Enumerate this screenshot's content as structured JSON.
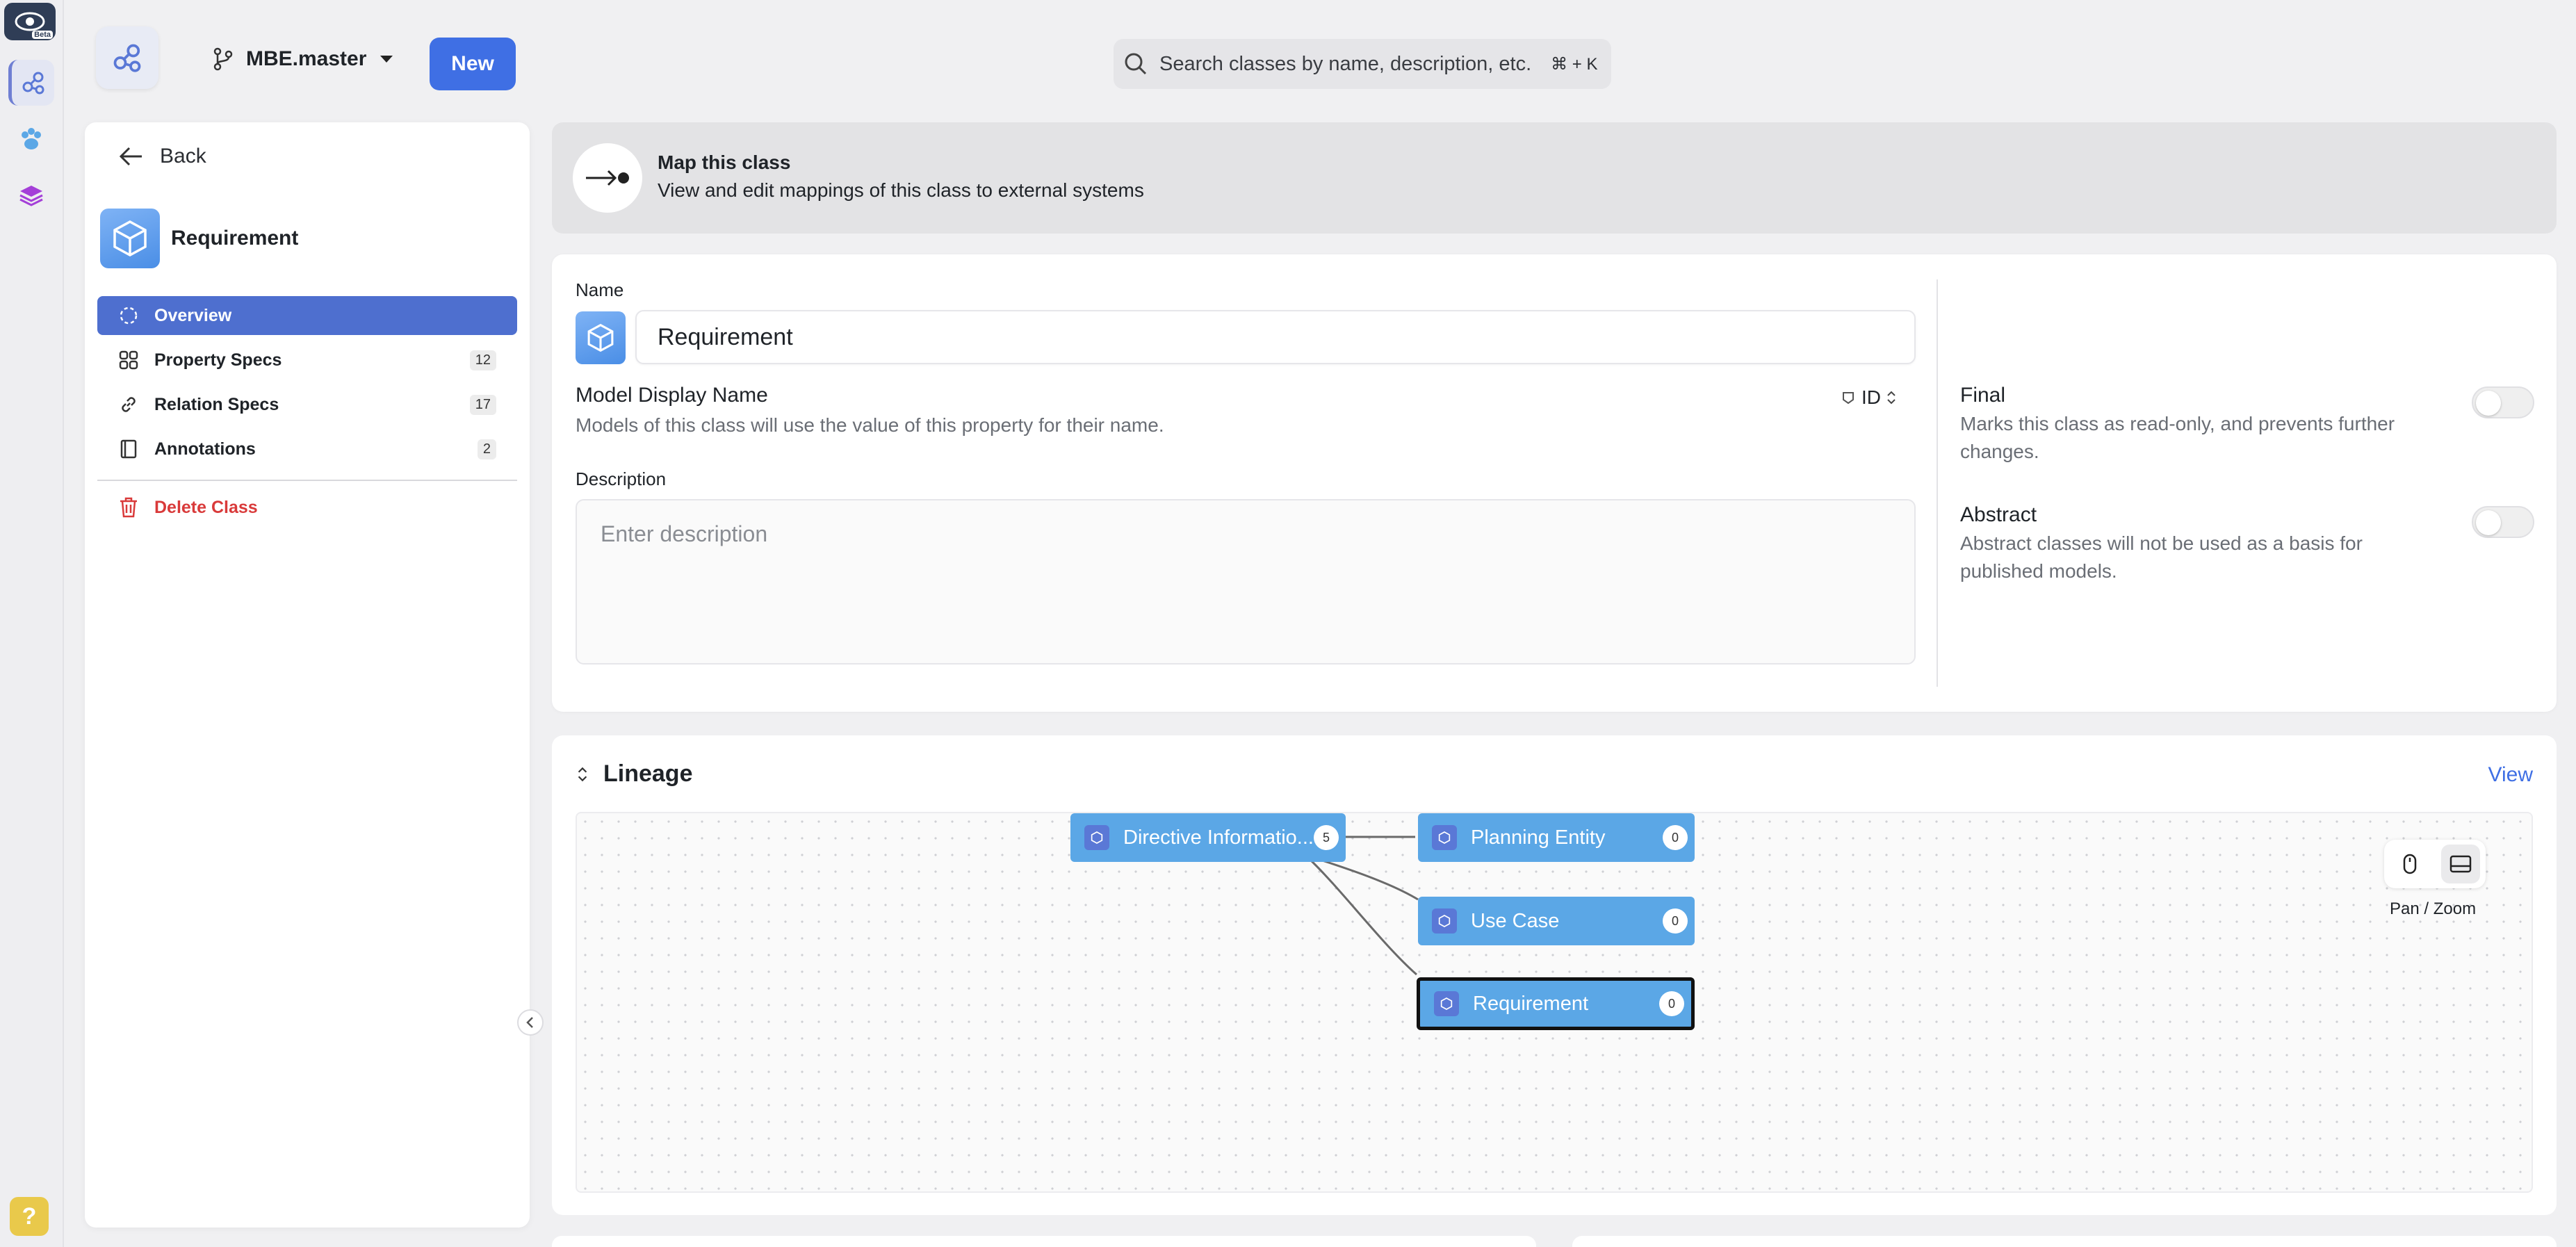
{
  "app": {
    "beta_label": "Beta",
    "help_label": "?",
    "branch": "MBE.master",
    "new_label": "New",
    "search_placeholder": "Search classes by name, description, etc.",
    "search_shortcut": "⌘ + K"
  },
  "sidebar": {
    "back_label": "Back",
    "class_name": "Requirement",
    "items": [
      {
        "label": "Overview",
        "count": ""
      },
      {
        "label": "Property Specs",
        "count": "12"
      },
      {
        "label": "Relation Specs",
        "count": "17"
      },
      {
        "label": "Annotations",
        "count": "2"
      }
    ],
    "delete_label": "Delete Class"
  },
  "banner": {
    "title": "Map this class",
    "subtitle": "View and edit mappings of this class to external systems"
  },
  "form": {
    "name_label": "Name",
    "name_value": "Requirement",
    "mdn_title": "Model Display Name",
    "mdn_sub": "Models of this class will use the value of this property for their name.",
    "mdn_value": "ID",
    "desc_label": "Description",
    "desc_placeholder": "Enter description",
    "final_title": "Final",
    "final_sub": "Marks this class as read-only, and prevents further changes.",
    "final_on": false,
    "abstract_title": "Abstract",
    "abstract_sub": "Abstract classes will not be used as a basis for published models.",
    "abstract_on": false
  },
  "lineage": {
    "title": "Lineage",
    "view_label": "View",
    "nodes": [
      {
        "label": "Directive Informatio...",
        "count": "5"
      },
      {
        "label": "Planning Entity",
        "count": "0"
      },
      {
        "label": "Use Case",
        "count": "0"
      },
      {
        "label": "Requirement",
        "count": "0"
      }
    ],
    "panzoom_label": "Pan / Zoom"
  },
  "colors": {
    "accent": "#3f6fe4",
    "nav_active": "#4e6fcf",
    "node": "#5ba7e6",
    "danger": "#d93a3a"
  }
}
